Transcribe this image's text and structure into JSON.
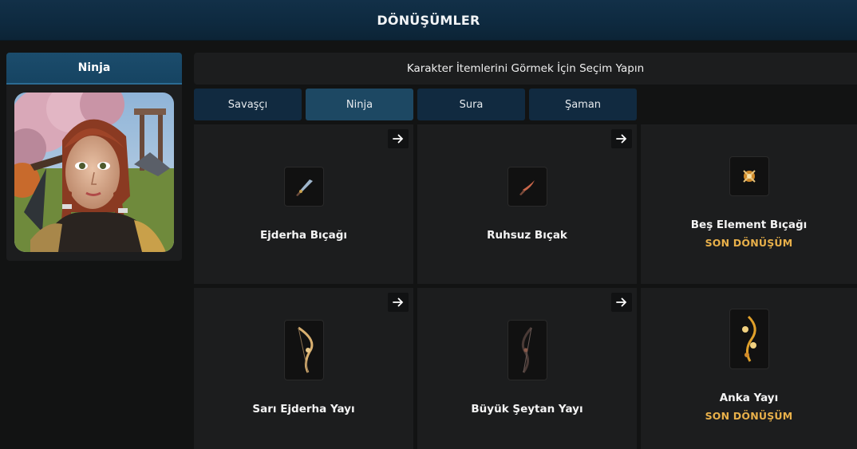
{
  "header": {
    "title": "DÖNÜŞÜMLER"
  },
  "character": {
    "name": "Ninja"
  },
  "info": {
    "text": "Karakter İtemlerini Görmek İçin Seçim Yapın"
  },
  "tabs": [
    {
      "label": "Savaşçı",
      "active": false
    },
    {
      "label": "Ninja",
      "active": true
    },
    {
      "label": "Sura",
      "active": false
    },
    {
      "label": "Şaman",
      "active": false
    }
  ],
  "items": [
    {
      "name": "Ejderha Bıçağı",
      "icon": "dagger-blue-icon",
      "has_next": true,
      "final_label": ""
    },
    {
      "name": "Ruhsuz Bıçak",
      "icon": "dagger-red-icon",
      "has_next": true,
      "final_label": ""
    },
    {
      "name": "Beş Element Bıçağı",
      "icon": "dagger-gold-icon",
      "has_next": false,
      "final_label": "SON DÖNÜŞÜM"
    },
    {
      "name": "Sarı Ejderha Yayı",
      "icon": "bow-gold-icon",
      "has_next": true,
      "final_label": ""
    },
    {
      "name": "Büyük Şeytan Yayı",
      "icon": "bow-dark-icon",
      "has_next": true,
      "final_label": ""
    },
    {
      "name": "Anka Yayı",
      "icon": "bow-phoenix-icon",
      "has_next": false,
      "final_label": "SON DÖNÜŞÜM"
    }
  ],
  "colors": {
    "header_bg": "#0e2a40",
    "active_tab": "#1d4863",
    "tab": "#112a40",
    "final_label": "#e8b04a",
    "card_bg": "#1c1d1e"
  }
}
